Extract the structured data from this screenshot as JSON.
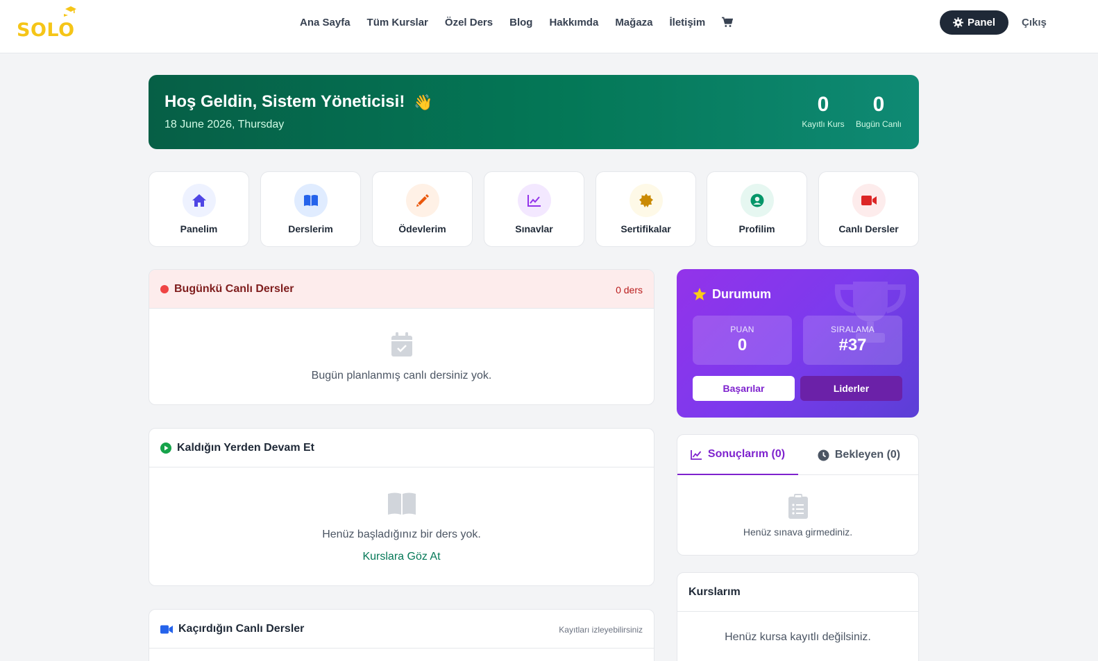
{
  "brand": {
    "logo_text": "SOLO",
    "colors": {
      "logo": "#f5c518",
      "primary_green": "#047857",
      "purple": "#7e22ce"
    }
  },
  "nav": {
    "links": [
      "Ana Sayfa",
      "Tüm Kurslar",
      "Özel Ders",
      "Blog",
      "Hakkımda",
      "Mağaza",
      "İletişim"
    ],
    "cart_icon": "cart-icon",
    "panel_label": "Panel",
    "logout_label": "Çıkış"
  },
  "welcome": {
    "title": "Hoş Geldin, Sistem Yöneticisi!",
    "emoji": "👋",
    "date": "18 June 2026, Thursday",
    "stats": [
      {
        "value": "0",
        "label": "Kayıtlı Kurs"
      },
      {
        "value": "0",
        "label": "Bugün Canlı"
      }
    ]
  },
  "quick_actions": [
    {
      "label": "Panelim",
      "icon": "home-icon"
    },
    {
      "label": "Derslerim",
      "icon": "book-icon"
    },
    {
      "label": "Ödevlerim",
      "icon": "pencil-icon"
    },
    {
      "label": "Sınavlar",
      "icon": "chart-line-icon"
    },
    {
      "label": "Sertifikalar",
      "icon": "certificate-icon"
    },
    {
      "label": "Profilim",
      "icon": "user-circle-icon"
    },
    {
      "label": "Canlı Dersler",
      "icon": "video-icon"
    }
  ],
  "today_live": {
    "title": "Bugünkü Canlı Dersler",
    "count": "0 ders",
    "empty": "Bugün planlanmış canlı dersiniz yok."
  },
  "continue": {
    "title": "Kaldığın Yerden Devam Et",
    "empty": "Henüz başladığınız bir ders yok.",
    "link": "Kurslara Göz At"
  },
  "missed": {
    "title": "Kaçırdığın Canlı Dersler",
    "note": "Kayıtları izleyebilirsiniz"
  },
  "status": {
    "title": "Durumum",
    "points_label": "PUAN",
    "points": "0",
    "rank_label": "SIRALAMA",
    "rank": "#37",
    "achievements": "Başarılar",
    "leaders": "Liderler"
  },
  "results": {
    "tab_results": "Sonuçlarım (0)",
    "tab_pending": "Bekleyen (0)",
    "empty": "Henüz sınava girmediniz."
  },
  "my_courses": {
    "title": "Kurslarım",
    "empty": "Henüz kursa kayıtlı değilsiniz."
  }
}
